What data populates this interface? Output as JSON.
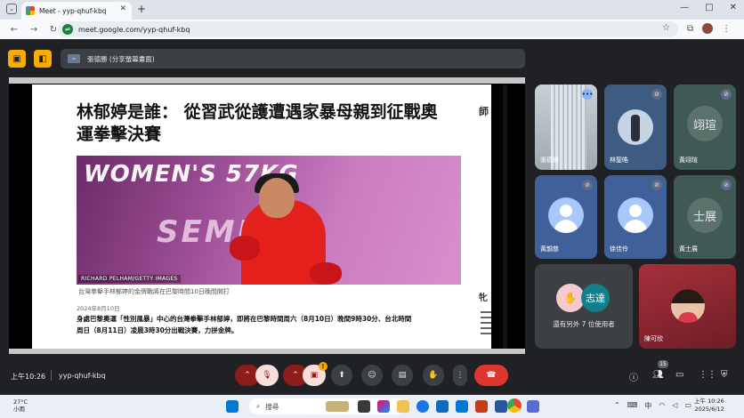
{
  "browser": {
    "tab_title": "Meet - yyp-qhuf-kbq",
    "url": "meet.google.com/yyp-qhuf-kbq",
    "window_buttons": [
      "—",
      "□",
      "✕"
    ]
  },
  "presenter": {
    "label": "張德勝 (分享螢幕畫面)"
  },
  "slide": {
    "headline": "林郁婷是誰： 從習武從護遭遇家暴母親到征戰奧運拳擊決賽",
    "hero_text_1": "WOMEN'S 57KG",
    "hero_text_2": "SEMI-",
    "photo_credit": "RICHARD PELHAM/GETTY IMAGES",
    "caption": "台灣拳擊手林郁婷的金牌戰將在巴黎時間10日晚間開打",
    "date": "2024年8月10日",
    "paragraph": "身處巴黎奧運「性別風暴」中心的台灣拳擊手林郁婷，即將在巴黎時間周六（8月10日）晚間9時30分、台北時間周日（8月11日）凌晨3時30分出戰決賽，力拼金牌。",
    "side_a": "師",
    "side_b": "牝"
  },
  "tiles": [
    {
      "name": "張德勝",
      "kind": "photo"
    },
    {
      "name": "林聖皓",
      "kind": "avatar"
    },
    {
      "name": "黃翊瑄",
      "kind": "initials",
      "initials": "翊瑄"
    },
    {
      "name": "黃韻慈",
      "kind": "person"
    },
    {
      "name": "徐佳伶",
      "kind": "person"
    },
    {
      "name": "黃士展",
      "kind": "initials",
      "initials": "士展"
    },
    {
      "name": "還有另外 7 位使用者",
      "kind": "more",
      "initials": "志達"
    },
    {
      "name": "陳可欣",
      "kind": "avatar"
    }
  ],
  "bottombar": {
    "time": "上午10:26",
    "meeting_code": "yyp-qhuf-kbq",
    "participant_count": "15",
    "badge": "!"
  },
  "taskbar": {
    "temperature": "27°C",
    "weather": "小雨",
    "search_placeholder": "搜尋",
    "clock_time": "上午 10:26",
    "clock_date": "2025/6/12",
    "ime": "中"
  },
  "colors": {
    "meet_bg": "#202124",
    "end_call": "#dc362e",
    "mic_off": "#f9dedc",
    "accent_yellow": "#f9ab00"
  }
}
